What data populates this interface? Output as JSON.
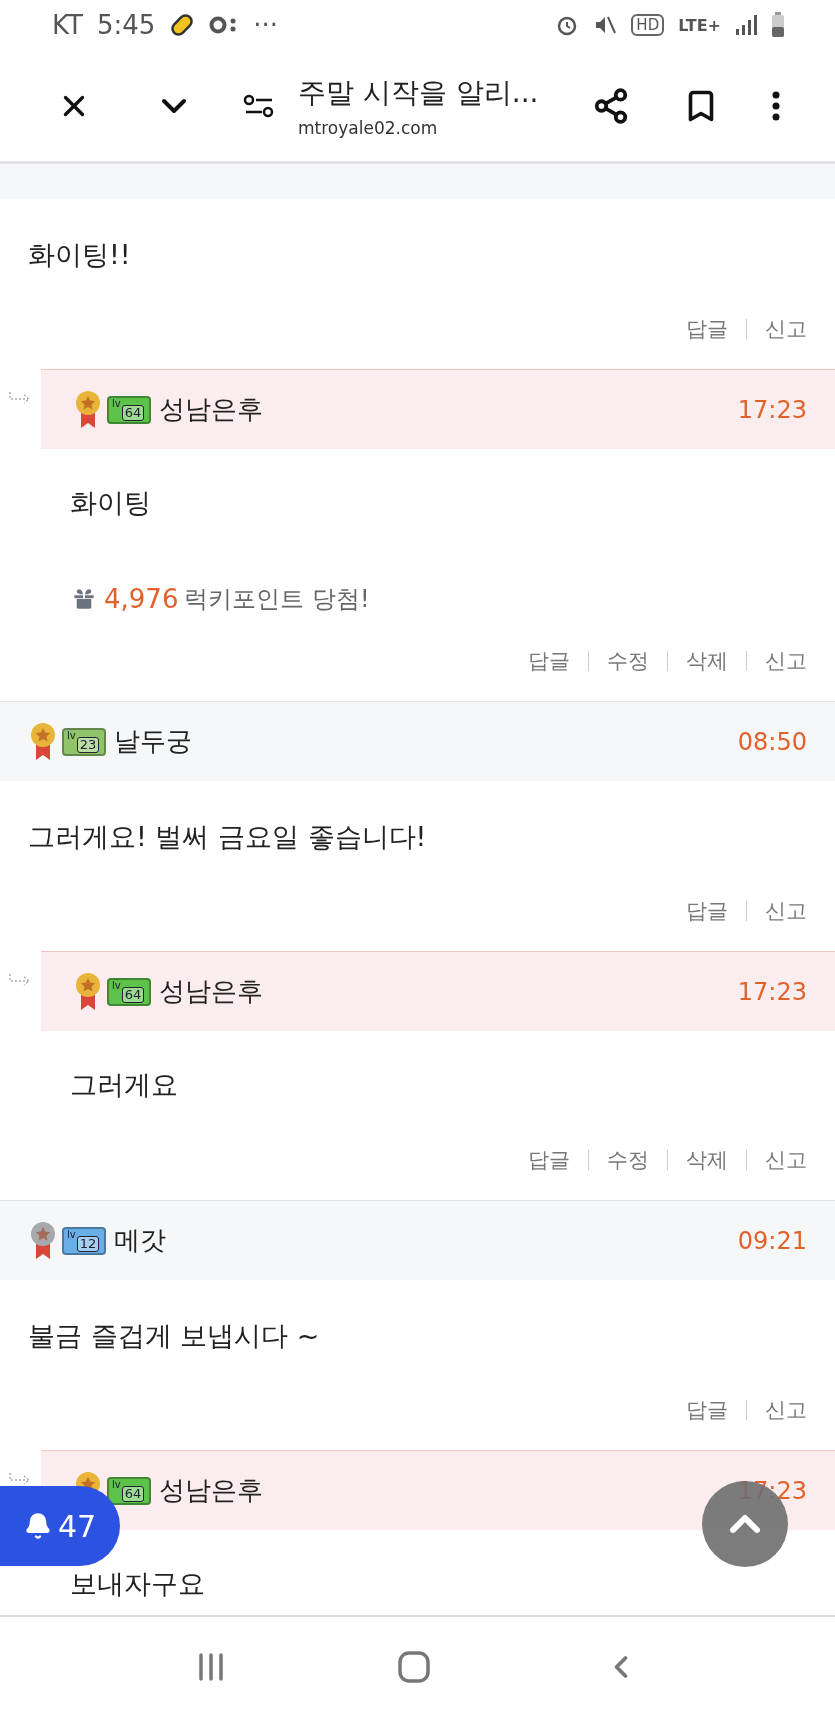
{
  "status_bar": {
    "carrier": "KT",
    "time": "5:45",
    "more": "···",
    "hd": "HD",
    "network": "LTE+"
  },
  "toolbar": {
    "title": "주말 시작을 알리...",
    "url": "mtroyale02.com"
  },
  "comments": [
    {
      "kind": "partial",
      "body": "화이팅!!",
      "actions": [
        "답글",
        "신고"
      ]
    },
    {
      "kind": "reply",
      "medal": {
        "color": "#e9b43a"
      },
      "rank": {
        "prefix": "lv",
        "number": "64",
        "color": "#5cc24a"
      },
      "author": "성남은후",
      "time": "17:23",
      "body": "화이팅",
      "lucky": {
        "points": "4,976",
        "text": "럭키포인트 당첨!"
      },
      "actions": [
        "답글",
        "수정",
        "삭제",
        "신고"
      ]
    },
    {
      "kind": "comment",
      "medal": {
        "color": "#e9b43a"
      },
      "rank": {
        "prefix": "lv",
        "number": "23",
        "color": "#8fc46a"
      },
      "author": "날두궁",
      "time": "08:50",
      "body": "그러게요! 벌써 금요일 좋습니다!",
      "actions": [
        "답글",
        "신고"
      ]
    },
    {
      "kind": "reply",
      "medal": {
        "color": "#e9b43a"
      },
      "rank": {
        "prefix": "lv",
        "number": "64",
        "color": "#5cc24a"
      },
      "author": "성남은후",
      "time": "17:23",
      "body": "그러게요",
      "actions": [
        "답글",
        "수정",
        "삭제",
        "신고"
      ]
    },
    {
      "kind": "comment",
      "medal": {
        "color": "#a7a9ad"
      },
      "rank": {
        "prefix": "lv",
        "number": "12",
        "color": "#6aaee8"
      },
      "author": "메갓",
      "time": "09:21",
      "body": "불금 즐겁게 보냅시다 ~",
      "actions": [
        "답글",
        "신고"
      ]
    },
    {
      "kind": "reply",
      "medal": {
        "color": "#e9b43a"
      },
      "rank": {
        "prefix": "lv",
        "number": "64",
        "color": "#5cc24a"
      },
      "author": "성남은후",
      "time": "17:23",
      "body": "보내자구요"
    }
  ],
  "notifications": {
    "count": "47"
  }
}
